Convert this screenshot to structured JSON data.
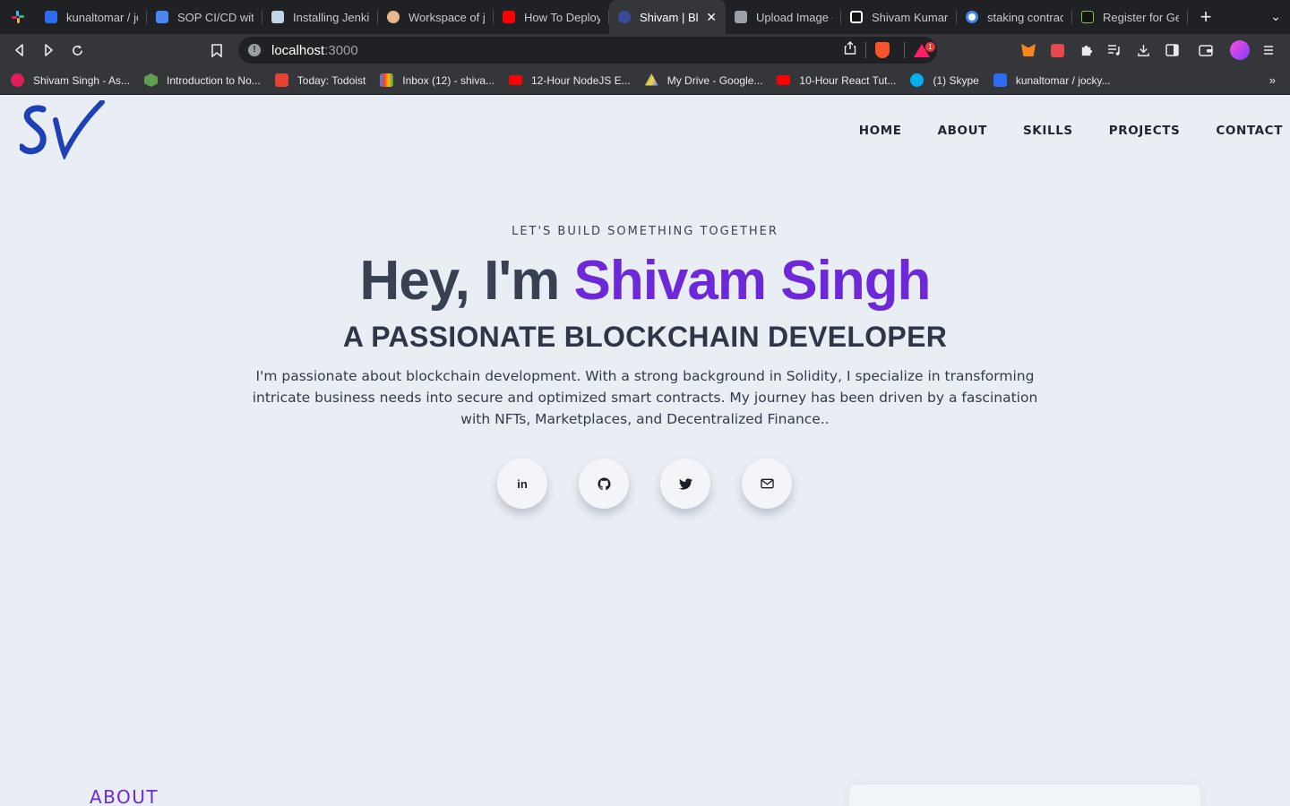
{
  "browser": {
    "tabs": [
      {
        "title": "kunaltomar / jocky",
        "favicon_color": "#2d6bf3",
        "active": false
      },
      {
        "title": "SOP CI/CD with",
        "favicon_color": "#4a86f0",
        "active": false
      },
      {
        "title": "Installing Jenkins",
        "favicon_color": "#c3d6e8",
        "active": false
      },
      {
        "title": "Workspace of jo",
        "favicon_color": "#e8b68a",
        "active": false
      },
      {
        "title": "How To Deploy a",
        "favicon_color": "#ff0000",
        "active": false
      },
      {
        "title": "Shivam | Blockchain",
        "favicon_color": "#3b4a9c",
        "active": true
      },
      {
        "title": "Upload Image –",
        "favicon_color": "#9aa0a6",
        "active": false
      },
      {
        "title": "Shivam Kumar S",
        "favicon_color": "#ffffff",
        "active": false
      },
      {
        "title": "staking contract",
        "favicon_color": "#ffffff",
        "active": false
      },
      {
        "title": "Register for Get",
        "favicon_color": "#111111",
        "active": false
      }
    ],
    "url_host": "localhost",
    "url_port": ":3000",
    "brave_badge": "1",
    "bookmarks": [
      {
        "title": "Shivam Singh - As...",
        "favicon_color": "#e01e5a"
      },
      {
        "title": "Introduction to No...",
        "favicon_color": "#5fa04e"
      },
      {
        "title": "Today: Todoist",
        "favicon_color": "#e44332"
      },
      {
        "title": "Inbox (12) - shiva...",
        "favicon_color": "#ea4335"
      },
      {
        "title": "12-Hour NodeJS E...",
        "favicon_color": "#ff0000"
      },
      {
        "title": "My Drive - Google...",
        "favicon_color": "#1fa463"
      },
      {
        "title": "10-Hour React Tut...",
        "favicon_color": "#ff0000"
      },
      {
        "title": "(1) Skype",
        "favicon_color": "#00aff0"
      },
      {
        "title": "kunaltomar / jocky...",
        "favicon_color": "#2d6bf3"
      }
    ]
  },
  "site": {
    "logo_text": "SV",
    "nav": [
      "HOME",
      "ABOUT",
      "SKILLS",
      "PROJECTS",
      "CONTACT"
    ],
    "hero": {
      "eyebrow": "LET'S BUILD SOMETHING TOGETHER",
      "greeting": "Hey, I'm ",
      "name": "Shivam Singh",
      "subtitle": "A PASSIONATE BLOCKCHAIN DEVELOPER",
      "bio": "I'm passionate about blockchain development. With a strong background in Solidity, I specialize in transforming intricate business needs into secure and optimized smart contracts. My journey has been driven by a fascination with NFTs, Marketplaces, and Decentralized Finance.."
    },
    "socials": [
      {
        "icon": "linkedin-icon",
        "glyph": "in"
      },
      {
        "icon": "github-icon"
      },
      {
        "icon": "twitter-icon"
      },
      {
        "icon": "mail-icon"
      }
    ],
    "about_heading": "ABOUT",
    "colors": {
      "accent": "#6d28d9",
      "page_bg": "#e9eef4",
      "text_dark": "#384152"
    }
  }
}
